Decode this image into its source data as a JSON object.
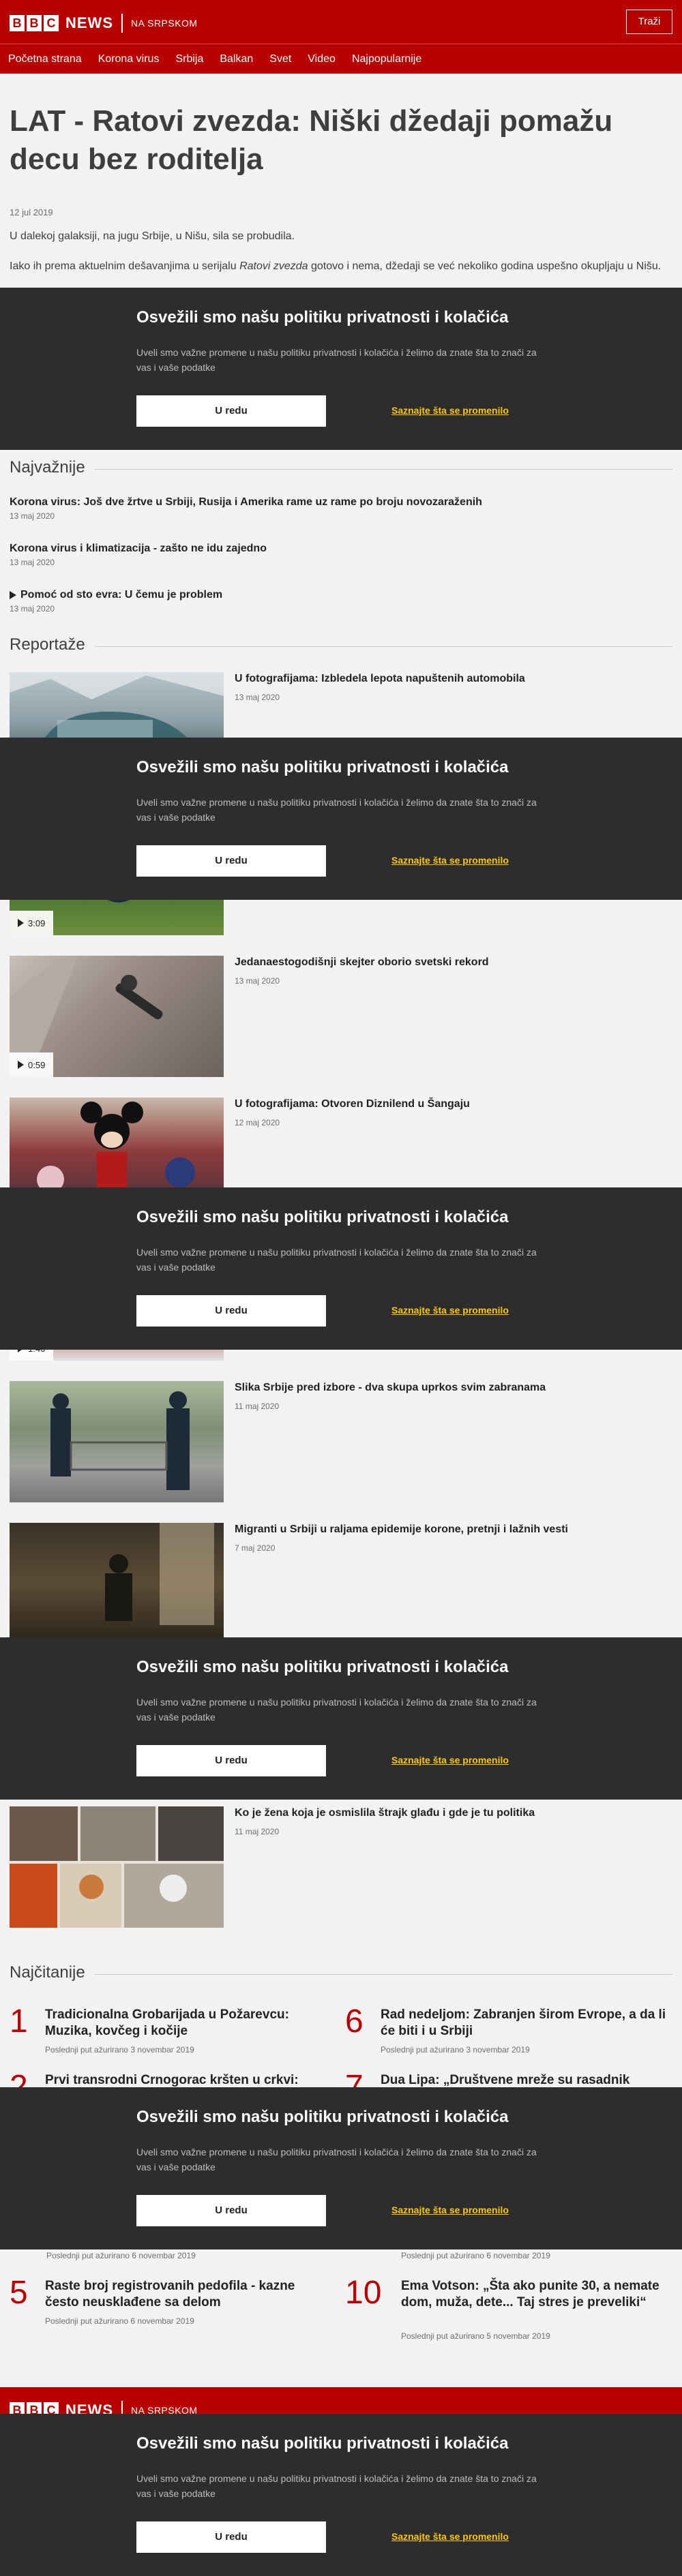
{
  "header": {
    "logo_letters": [
      "B",
      "B",
      "C"
    ],
    "logo_word": "NEWS",
    "service": "NA SRPSKOM",
    "search_label": "Traži"
  },
  "nav": {
    "items": [
      "Početna strana",
      "Korona virus",
      "Srbija",
      "Balkan",
      "Svet",
      "Video",
      "Najpopularnije"
    ]
  },
  "article": {
    "headline": "LAT - Ratovi zvezda: Niški džedaji pomažu decu bez roditelja",
    "date": "12 jul 2019",
    "para1": "U dalekoj galaksiji, na jugu Srbije, u Nišu, sila se probudila.",
    "para2_before": "Iako ih prema aktuelnim dešavanjima u serijalu ",
    "para2_em": "Ratovi zvezda",
    "para2_after": " gotovo i nema, džedaji se već nekoliko godina uspešno okupljaju u Nišu."
  },
  "top_stories": {
    "title": "Najvažnije",
    "items": [
      {
        "title": "Korona virus: Još dve žrtve u Srbiji, Rusija i Amerika rame uz rame po broju novozaraženih",
        "date": "13 maj 2020"
      },
      {
        "title": "Korona virus i klimatizacija - zašto ne idu zajedno",
        "date": "13 maj 2020"
      },
      {
        "title": "Pomoć od sto evra: U čemu je problem",
        "date": "13 maj 2020"
      }
    ]
  },
  "features": {
    "title": "Reportaže",
    "items": [
      {
        "title": "U fotografijama: Izbledela lepota napuštenih automobila",
        "date": "13 maj 2020"
      },
      {
        "title": "",
        "date": "",
        "duration": "3:09"
      },
      {
        "title": "Jedanaestogodišnji skejter oborio svetski rekord",
        "date": "13 maj 2020",
        "duration": "0:59"
      },
      {
        "title": "U fotografijama: Otvoren Diznilend u Šangaju",
        "date": "12 maj 2020"
      },
      {
        "title": "",
        "date": "",
        "duration": "1:46"
      },
      {
        "title": "Slika Srbije pred izbore - dva skupa uprkos svim zabranama",
        "date": "11 maj 2020"
      },
      {
        "title": "Migranti u Srbiji u raljama epidemije korone, pretnji i lažnih vesti",
        "date": "7 maj 2020"
      },
      {
        "title": "",
        "date": ""
      },
      {
        "title": "Ko je žena koja je osmislila štrajk glađu i gde je tu politika",
        "date": "11 maj 2020"
      }
    ]
  },
  "most_read": {
    "title": "Najčitanije",
    "items": [
      {
        "num": "1",
        "title": "Tradicionalna Grobarijada u Požarevcu: Muzika, kovčeg i kočije",
        "date": "Poslednji put ažurirano 3 novembar 2019"
      },
      {
        "num": "2",
        "title": "Prvi transrodni Crnogorac kršten u crkvi:",
        "date": ""
      },
      {
        "num": "5",
        "title": "Raste broj registrovanih pedofila - kazne često neusklađene sa delom",
        "date": "Poslednji put ažurirano 6 novembar 2019"
      },
      {
        "num": "6",
        "title": "Rad nedeljom: Zabranjen širom Evrope, a da li će biti i u Srbiji",
        "date": "Poslednji put ažurirano 3 novembar 2019"
      },
      {
        "num": "7",
        "title": "Dua Lipa: „Društvene mreže su rasadnik",
        "date": ""
      },
      {
        "num": "10",
        "title": "Ema Votson: „Šta ako punite 30, a nemate dom, muža, dete... Taj stres je preveliki“",
        "date": "Poslednji put ažurirano 5 novembar 2019"
      }
    ],
    "partial_dates": [
      "Poslednji put ažurirano 6 novembar 2019",
      "Poslednji put ažurirano 6 novembar 2019"
    ]
  },
  "cookie": {
    "title": "Osvežili smo našu politiku privatnosti i kolačića",
    "text": "Uveli smo važne promene u našu politiku privatnosti i kolačića i želimo da znate šta to znači za vas i vaše podatke",
    "ok_label": "U redu",
    "learn_label": "Saznajte šta se promenilo"
  },
  "colors": {
    "brand": "#b80000",
    "cookie_bg": "#2d2d2d",
    "link": "#fdc800"
  }
}
